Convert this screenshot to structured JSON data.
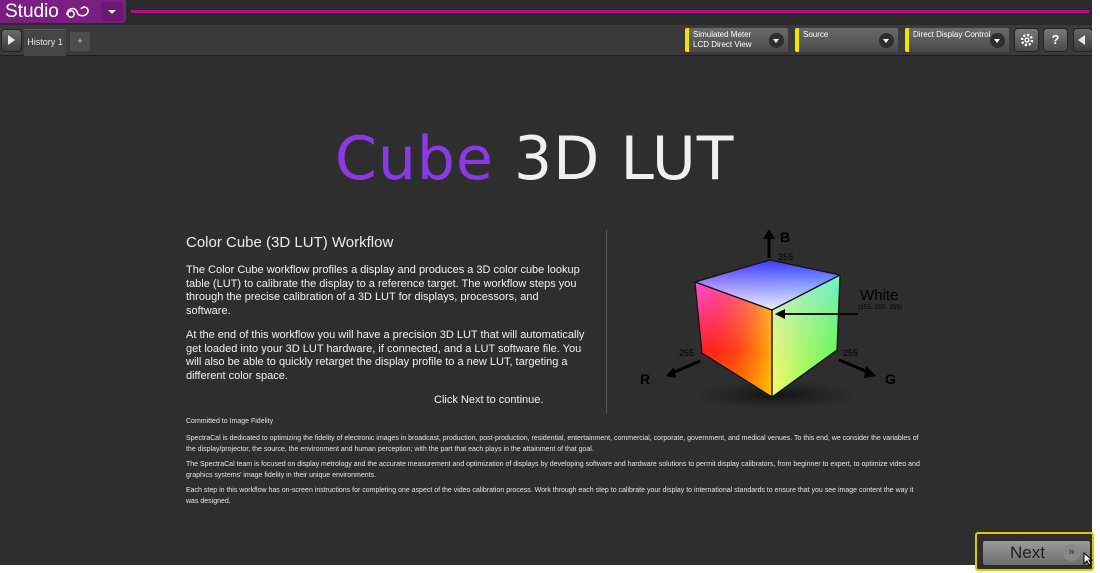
{
  "app": {
    "logo_text": "Studio",
    "history_tab": "History 1",
    "add_tab": "+"
  },
  "toolbar": {
    "meter": {
      "line1": "Simulated Meter",
      "line2": "LCD Direct View"
    },
    "source": {
      "line1": "Source",
      "line2": ""
    },
    "display_control": {
      "line1": "Direct Display Control",
      "line2": ""
    },
    "help_label": "?"
  },
  "hero": {
    "part1": "Cube",
    "part2": "3D LUT"
  },
  "workflow": {
    "title": "Color Cube (3D LUT) Workflow",
    "paragraph1": "The Color Cube workflow profiles a display and produces a 3D color cube lookup table (LUT) to calibrate the display to a reference target. The workflow steps you through the precise calibration of a 3D LUT for displays, processors, and software.",
    "paragraph2": "At the end of this workflow you will have a precision 3D LUT that will automatically get loaded into your 3D LUT hardware, if connected, and a LUT software file.  You will also be able to quickly retarget the display profile to a new LUT, targeting a different color space.",
    "click_next": "Click Next to continue."
  },
  "fidelity": {
    "title": "Committed to Image Fidelity",
    "p1": "SpectraCal is dedicated to optimizing the fidelity of electronic images in broadcast, production, post-production, residential, entertainment, commercial, corporate, government, and medical venues. To this end, we consider the variables of the display/projector, the source, the environment and human perception; with the part that each plays in the attainment of that goal.",
    "p2": "The SpectraCal team is focused on display metrology and the accurate measurement and optimization of displays by developing software and hardware solutions to permit display calibrators, from beginner to expert, to optimize video and graphics systems' image fidelity in their unique environments.",
    "p3": "Each step in this workflow has on-screen instructions for completing one aspect of the video calibration process. Work through each step to calibrate your display to international standards to ensure that you see image content the way it was designed."
  },
  "cube": {
    "axis_b": "B",
    "axis_r": "R",
    "axis_g": "G",
    "val_b": "255",
    "val_r": "255",
    "val_g": "255",
    "white_label": "White",
    "white_values": "(255, 255, 255)"
  },
  "next_button": {
    "label": "Next",
    "icon": "»"
  },
  "colors": {
    "accent": "#8b39e6",
    "brand": "#7a1f82",
    "highlight": "#e0c800"
  }
}
